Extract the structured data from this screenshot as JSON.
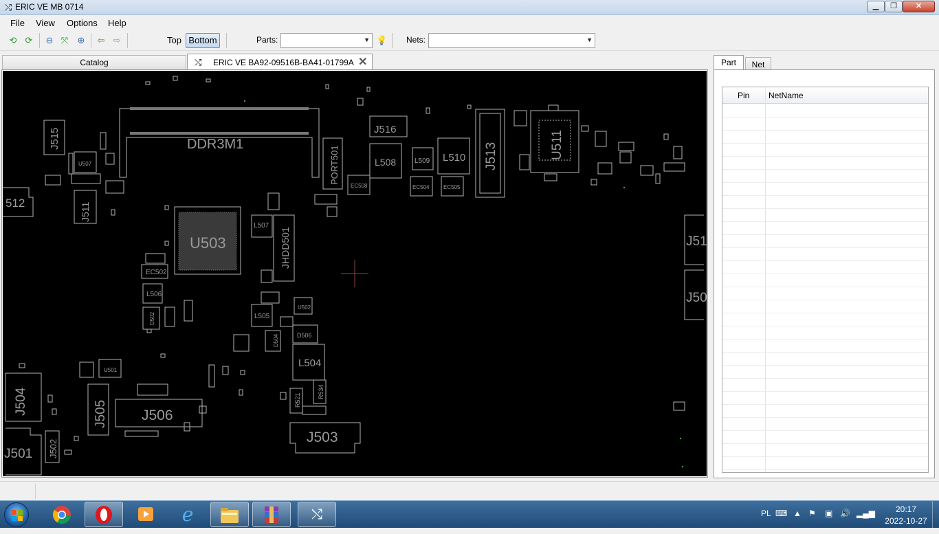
{
  "window": {
    "title": "ERIC VE MB 0714",
    "min_glyph": "▁",
    "max_glyph": "❐",
    "close_glyph": "✕"
  },
  "menu": [
    "File",
    "View",
    "Options",
    "Help"
  ],
  "toolbar": {
    "top_label": "Top",
    "bottom_label": "Bottom",
    "parts_label": "Parts:",
    "parts_value": "",
    "nets_label": "Nets:",
    "nets_value": "",
    "icons": [
      "rotate-left-icon",
      "rotate-right-icon",
      "zoom-out-icon",
      "fit-icon",
      "zoom-in-icon",
      "back-arrow-icon",
      "forward-arrow-icon",
      "light-bulb-icon"
    ]
  },
  "tabs": {
    "catalog": "Catalog",
    "board": "ERIC VE BA92-09516B-BA41-01799A"
  },
  "board": {
    "labels": [
      {
        "text": "DDR3M1"
      },
      {
        "text": "J516"
      },
      {
        "text": "L508"
      },
      {
        "text": "L509"
      },
      {
        "text": "L510"
      },
      {
        "text": "J513"
      },
      {
        "text": "U511"
      },
      {
        "text": "PORT501"
      },
      {
        "text": "EC508"
      },
      {
        "text": "EC504"
      },
      {
        "text": "EC505"
      },
      {
        "text": "J515"
      },
      {
        "text": "U507"
      },
      {
        "text": "512"
      },
      {
        "text": "J511"
      },
      {
        "text": "U503"
      },
      {
        "text": "L507"
      },
      {
        "text": "JHDD501"
      },
      {
        "text": "EC502"
      },
      {
        "text": "L506"
      },
      {
        "text": "D502"
      },
      {
        "text": "L505"
      },
      {
        "text": "U502"
      },
      {
        "text": "D504"
      },
      {
        "text": "D506"
      },
      {
        "text": "L504"
      },
      {
        "text": "U501"
      },
      {
        "text": "J504"
      },
      {
        "text": "J505"
      },
      {
        "text": "J506"
      },
      {
        "text": "R521"
      },
      {
        "text": "R534"
      },
      {
        "text": "J503"
      },
      {
        "text": "J501"
      },
      {
        "text": "J502"
      },
      {
        "text": "J51"
      },
      {
        "text": "J50"
      }
    ]
  },
  "right_panel": {
    "tab_part": "Part",
    "tab_net": "Net",
    "col_pin": "Pin",
    "col_netname": "NetName"
  },
  "taskbar": {
    "lang": "PL",
    "time": "20:17",
    "date": "2022-10-27",
    "apps": [
      "chrome-icon",
      "opera-icon",
      "media-player-icon",
      "internet-explorer-icon",
      "explorer-icon",
      "winrar-icon",
      "boardviewer-icon"
    ]
  },
  "colors": {
    "canvas_bg": "#000000",
    "trace": "#b4b4b4",
    "label": "#9a9a9a"
  }
}
